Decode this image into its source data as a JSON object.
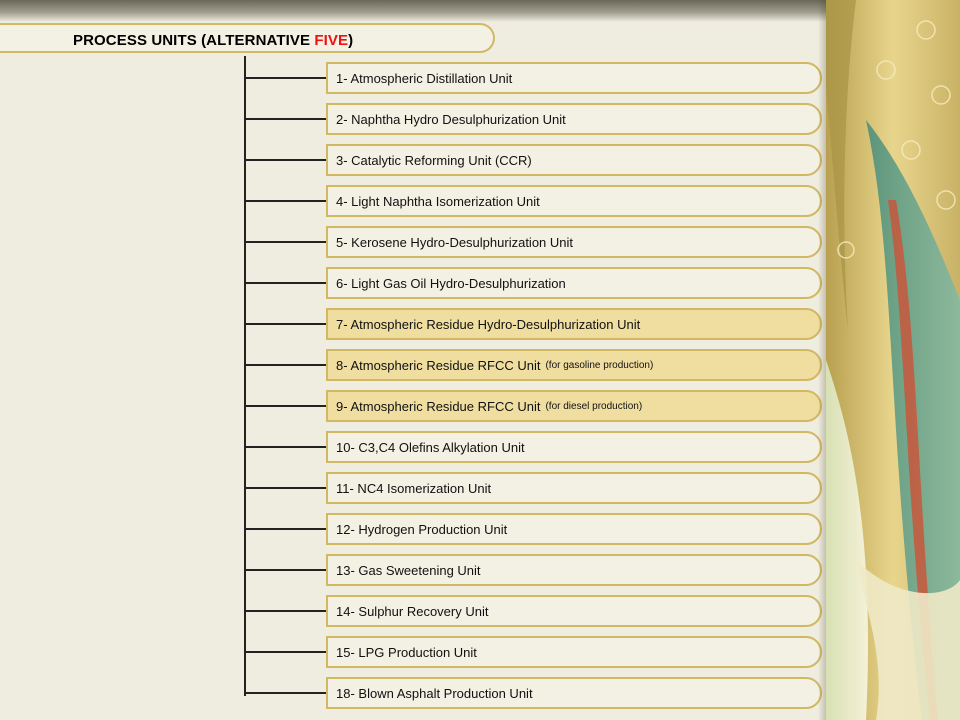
{
  "title": {
    "text": "PROCESS UNITS (ALTERNATIVE ",
    "highlight": "FIVE",
    "close": ")"
  },
  "units": [
    {
      "label": "1- Atmospheric Distillation Unit",
      "note": "",
      "highlight": false
    },
    {
      "label": "2- Naphtha Hydro Desulphurization Unit",
      "note": "",
      "highlight": false
    },
    {
      "label": "3- Catalytic Reforming Unit (CCR)",
      "note": "",
      "highlight": false
    },
    {
      "label": "4- Light Naphtha Isomerization Unit",
      "note": "",
      "highlight": false
    },
    {
      "label": "5- Kerosene Hydro-Desulphurization Unit",
      "note": "",
      "highlight": false
    },
    {
      "label": "6- Light Gas Oil Hydro-Desulphurization",
      "note": "",
      "highlight": false
    },
    {
      "label": "7- Atmospheric Residue Hydro-Desulphurization Unit",
      "note": "",
      "highlight": true
    },
    {
      "label": "8- Atmospheric Residue RFCC Unit",
      "note": "(for gasoline production)",
      "highlight": true
    },
    {
      "label": "9-  Atmospheric Residue RFCC Unit",
      "note": "(for diesel production)",
      "highlight": true
    },
    {
      "label": "10- C3,C4 Olefins Alkylation Unit",
      "note": "",
      "highlight": false
    },
    {
      "label": "11- NC4 Isomerization Unit",
      "note": "",
      "highlight": false
    },
    {
      "label": "12- Hydrogen Production Unit",
      "note": "",
      "highlight": false
    },
    {
      "label": "13- Gas Sweetening Unit",
      "note": "",
      "highlight": false
    },
    {
      "label": "14- Sulphur Recovery Unit",
      "note": "",
      "highlight": false
    },
    {
      "label": "15- LPG Production Unit",
      "note": "",
      "highlight": false
    },
    {
      "label": "18- Blown Asphalt Production Unit",
      "note": "",
      "highlight": false
    }
  ],
  "colors": {
    "box_border": "#d2b863",
    "highlight_fill": "#f0dea0",
    "title_accent": "#ee1111"
  }
}
